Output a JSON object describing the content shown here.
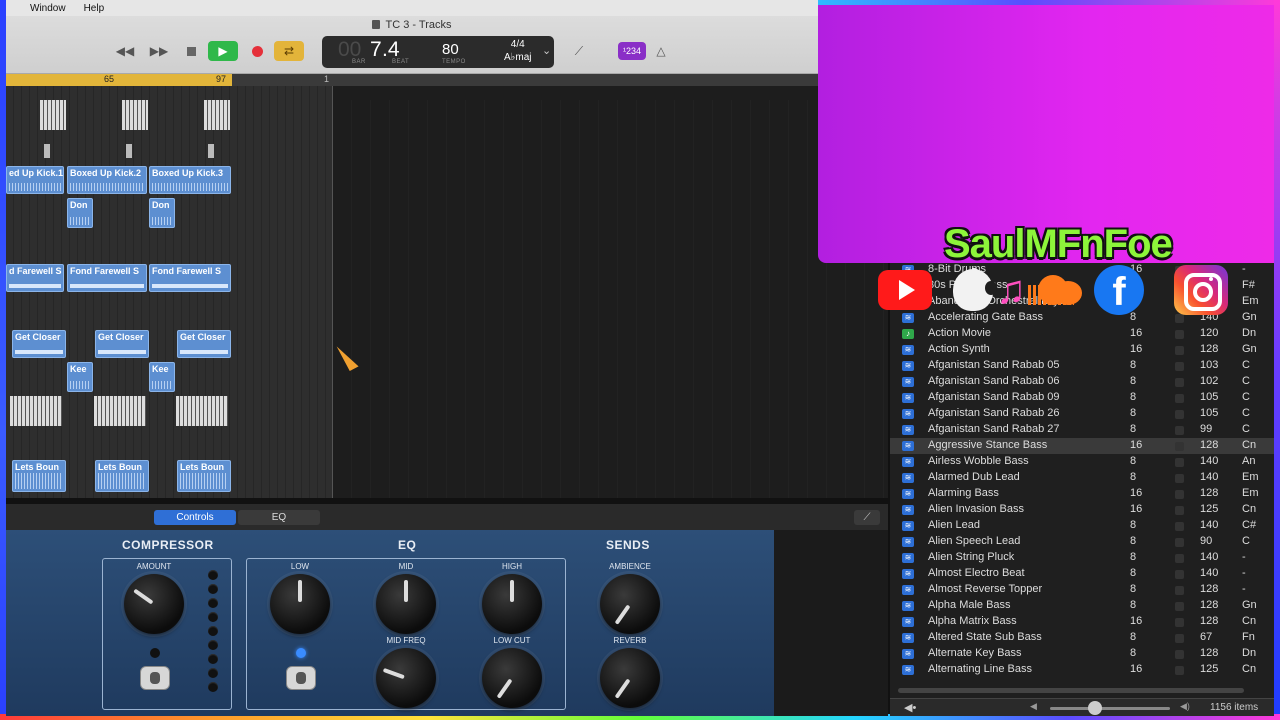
{
  "menubar": {
    "items": [
      "Window",
      "Help"
    ]
  },
  "window": {
    "title": "TC 3 - Tracks"
  },
  "transport": {
    "rewind_icon": "rewind-icon",
    "forward_icon": "fast-forward-icon",
    "stop_icon": "stop-icon",
    "play_icon": "play-icon",
    "record_icon": "record-icon",
    "cycle_icon": "cycle-icon"
  },
  "lcd": {
    "bar_dim": "00",
    "bar": "7",
    "beat": ".4",
    "bar_label": "BAR",
    "beat_label": "BEAT",
    "tempo": "80",
    "tempo_label": "TEMPO",
    "signature": "4/4",
    "key": "A♭maj"
  },
  "count_in": "¹234",
  "ruler": {
    "marks": [
      "65",
      "97",
      "1"
    ]
  },
  "regions": {
    "kick1": "ed Up Kick.1",
    "kick2": "Boxed Up Kick.2",
    "kick3": "Boxed Up Kick.3",
    "don1": "Don",
    "don2": "Don",
    "farewell1": "d Farewell S",
    "farewell2": "Fond Farewell S",
    "farewell3": "Fond Farewell S",
    "closer1": "Get Closer",
    "closer2": "Get Closer",
    "closer3": "Get Closer",
    "kee1": "Kee",
    "kee2": "Kee",
    "bounce1": "Lets Boun",
    "bounce2": "Lets Boun",
    "bounce3": "Lets Boun"
  },
  "smart_controls": {
    "tabs": [
      "Controls",
      "EQ"
    ],
    "compressor": {
      "title": "COMPRESSOR",
      "amount": "AMOUNT"
    },
    "eq": {
      "title": "EQ",
      "low": "LOW",
      "mid": "MID",
      "high": "HIGH",
      "mid_freq": "MID FREQ",
      "low_cut": "LOW CUT"
    },
    "sends": {
      "title": "SENDS",
      "ambience": "AMBIENCE",
      "reverb": "REVERB"
    }
  },
  "loops": {
    "rows": [
      {
        "name": "8-Bit Drums",
        "beats": "16",
        "tempo": "",
        "key": "-",
        "icon": "blue"
      },
      {
        "name": "80s Power Bass",
        "beats": "",
        "tempo": "",
        "key": "F#",
        "icon": "blue"
      },
      {
        "name": "Abandoned Orchestral Layers",
        "beats": "",
        "tempo": "",
        "key": "Em",
        "icon": "blue"
      },
      {
        "name": "Accelerating Gate Bass",
        "beats": "8",
        "tempo": "140",
        "key": "Gn",
        "icon": "blue"
      },
      {
        "name": "Action Movie",
        "beats": "16",
        "tempo": "120",
        "key": "Dn",
        "icon": "green"
      },
      {
        "name": "Action Synth",
        "beats": "16",
        "tempo": "128",
        "key": "Gn",
        "icon": "blue"
      },
      {
        "name": "Afganistan Sand Rabab 05",
        "beats": "8",
        "tempo": "103",
        "key": "C",
        "icon": "blue"
      },
      {
        "name": "Afganistan Sand Rabab 06",
        "beats": "8",
        "tempo": "102",
        "key": "C",
        "icon": "blue"
      },
      {
        "name": "Afganistan Sand Rabab 09",
        "beats": "8",
        "tempo": "105",
        "key": "C",
        "icon": "blue"
      },
      {
        "name": "Afganistan Sand Rabab 26",
        "beats": "8",
        "tempo": "105",
        "key": "C",
        "icon": "blue"
      },
      {
        "name": "Afganistan Sand Rabab 27",
        "beats": "8",
        "tempo": "99",
        "key": "C",
        "icon": "blue"
      },
      {
        "name": "Aggressive Stance Bass",
        "beats": "16",
        "tempo": "128",
        "key": "Cn",
        "icon": "blue"
      },
      {
        "name": "Airless Wobble Bass",
        "beats": "8",
        "tempo": "140",
        "key": "An",
        "icon": "blue"
      },
      {
        "name": "Alarmed Dub Lead",
        "beats": "8",
        "tempo": "140",
        "key": "Em",
        "icon": "blue"
      },
      {
        "name": "Alarming Bass",
        "beats": "16",
        "tempo": "128",
        "key": "Em",
        "icon": "blue"
      },
      {
        "name": "Alien Invasion Bass",
        "beats": "16",
        "tempo": "125",
        "key": "Cn",
        "icon": "blue"
      },
      {
        "name": "Alien Lead",
        "beats": "8",
        "tempo": "140",
        "key": "C#",
        "icon": "blue"
      },
      {
        "name": "Alien Speech Lead",
        "beats": "8",
        "tempo": "90",
        "key": "C",
        "icon": "blue"
      },
      {
        "name": "Alien String Pluck",
        "beats": "8",
        "tempo": "140",
        "key": "-",
        "icon": "blue"
      },
      {
        "name": "Almost Electro Beat",
        "beats": "8",
        "tempo": "140",
        "key": "-",
        "icon": "blue"
      },
      {
        "name": "Almost Reverse Topper",
        "beats": "8",
        "tempo": "128",
        "key": "-",
        "icon": "blue"
      },
      {
        "name": "Alpha Male Bass",
        "beats": "8",
        "tempo": "128",
        "key": "Gn",
        "icon": "blue"
      },
      {
        "name": "Alpha Matrix Bass",
        "beats": "16",
        "tempo": "128",
        "key": "Cn",
        "icon": "blue"
      },
      {
        "name": "Altered State Sub Bass",
        "beats": "8",
        "tempo": "67",
        "key": "Fn",
        "icon": "blue"
      },
      {
        "name": "Alternate Key Bass",
        "beats": "8",
        "tempo": "128",
        "key": "Dn",
        "icon": "blue"
      },
      {
        "name": "Alternating Line Bass",
        "beats": "16",
        "tempo": "125",
        "key": "Cn",
        "icon": "blue"
      }
    ],
    "highlight_index": 11,
    "item_count": "1156 items"
  },
  "overlay": {
    "brand": "SaulMFnFoe",
    "colors": {
      "brand_text": "#8df53a",
      "panel": "#e326f0"
    },
    "icons": [
      "youtube-icon",
      "apple-icon",
      "music-note-icon",
      "soundcloud-icon",
      "facebook-icon",
      "instagram-icon"
    ]
  }
}
